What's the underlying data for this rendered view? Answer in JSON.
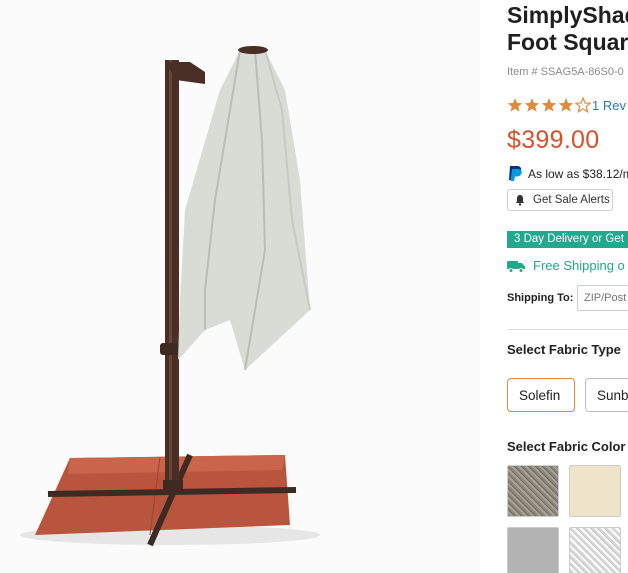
{
  "product": {
    "title_line1": "SimplyShade",
    "title_line2": "Foot Square",
    "item_number": "Item # SSAG5A-86S0-0",
    "rating_stars": 4,
    "rating_max": 5,
    "reviews_label": "1 Rev",
    "price": "$399.00",
    "paypal_text": "As low as $38.12/m"
  },
  "actions": {
    "sale_alert_label": "Get Sale Alerts"
  },
  "delivery": {
    "banner_text": "3 Day Delivery or Get",
    "free_shipping_text": "Free Shipping o",
    "shipping_to_label": "Shipping To:",
    "zip_placeholder": "ZIP/Post"
  },
  "options": {
    "fabric_type_label": "Select Fabric Type",
    "fabric_types": [
      "Solefin",
      "Sunb"
    ],
    "selected_fabric_type": "Solefin",
    "fabric_color_label": "Select Fabric Color"
  },
  "colors": {
    "price": "#d9502a",
    "star": "#e08a3c",
    "teal": "#21a88d",
    "link": "#2a7ab8"
  }
}
